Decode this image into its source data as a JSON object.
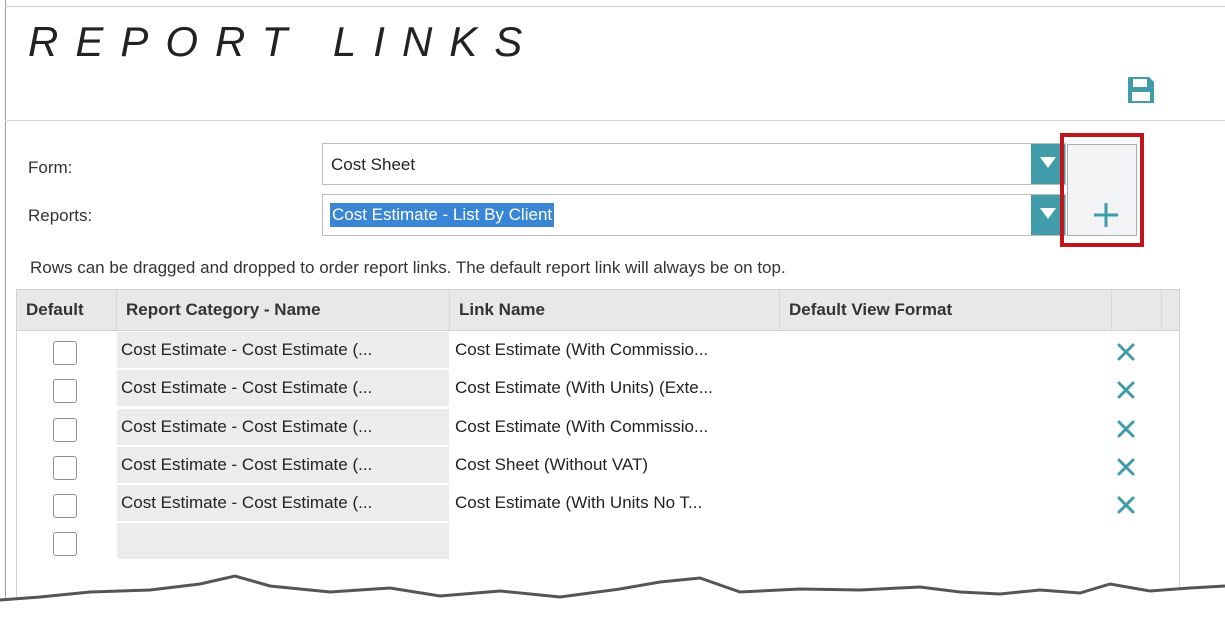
{
  "title": "REPORT LINKS",
  "form": {
    "label": "Form:",
    "value": "Cost Sheet"
  },
  "reports": {
    "label": "Reports:",
    "value": "Cost Estimate - List By Client"
  },
  "hint": "Rows can be dragged and dropped to order report links. The default report link will always be on top.",
  "table": {
    "headers": {
      "default": "Default",
      "category": "Report Category - Name",
      "link": "Link Name",
      "format": "Default View Format"
    },
    "rows": [
      {
        "category": "Cost Estimate - Cost Estimate (...",
        "link": "Cost Estimate (With Commissio..."
      },
      {
        "category": "Cost Estimate - Cost Estimate (...",
        "link": "Cost Estimate (With Units) (Exte..."
      },
      {
        "category": "Cost Estimate - Cost Estimate (...",
        "link": "Cost Estimate (With Commissio..."
      },
      {
        "category": "Cost Estimate - Cost Estimate (...",
        "link": "Cost Sheet (Without VAT)"
      },
      {
        "category": "Cost Estimate - Cost Estimate (...",
        "link": "Cost Estimate (With Units No T..."
      }
    ]
  },
  "icons": {
    "save": "save-icon",
    "dropdown": "chevron-down-icon",
    "add": "plus-icon",
    "delete": "close-icon"
  },
  "colors": {
    "accent": "#3f9ca8",
    "highlight": "#c0151b",
    "selection": "#3a86d6"
  }
}
